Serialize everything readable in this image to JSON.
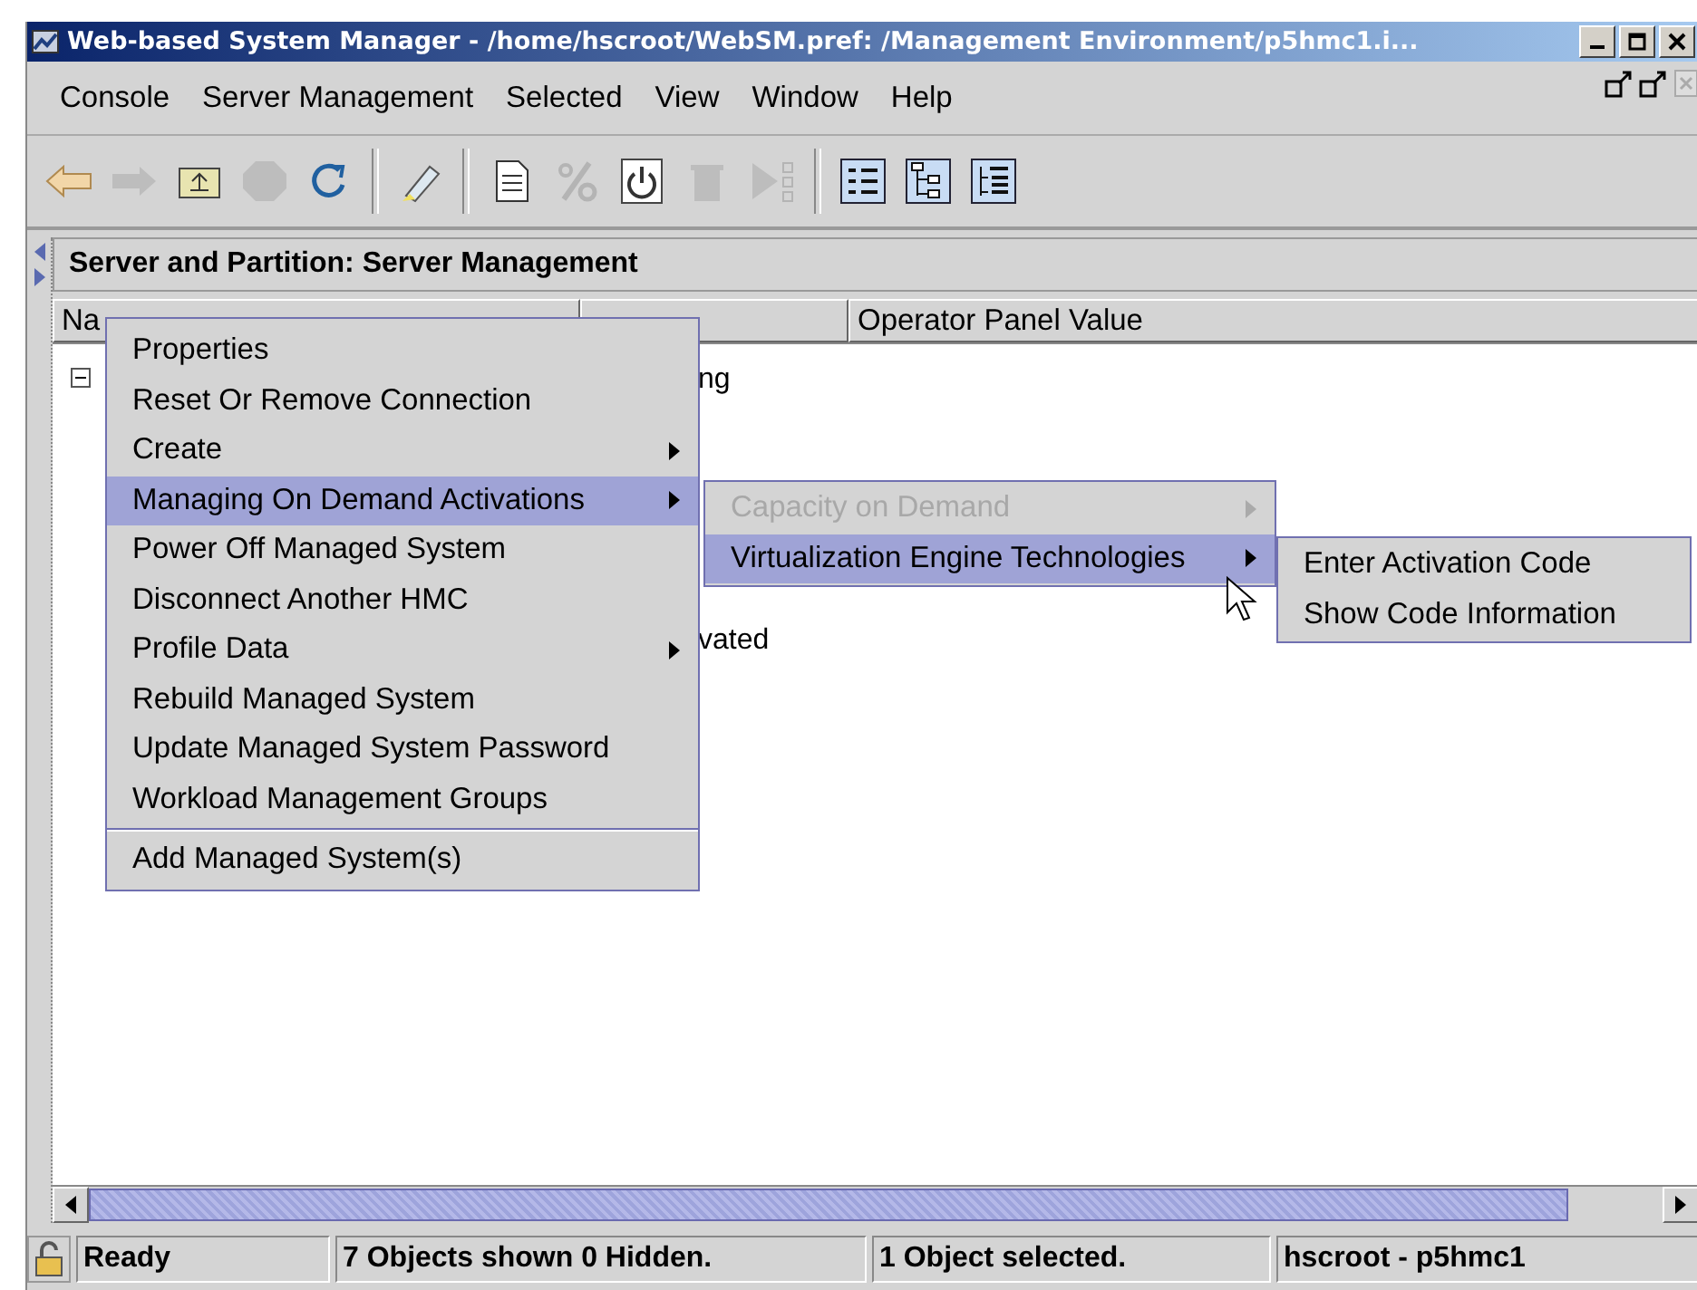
{
  "window": {
    "title": "Web-based System Manager - /home/hscroot/WebSM.pref: /Management Environment/p5hmc1.i..."
  },
  "menu_bar": [
    {
      "label": "Console"
    },
    {
      "label": "Server Management"
    },
    {
      "label": "Selected"
    },
    {
      "label": "View"
    },
    {
      "label": "Window"
    },
    {
      "label": "Help"
    }
  ],
  "toolbar": [
    [
      {
        "kind": "back",
        "disabled": false
      },
      {
        "kind": "forward",
        "disabled": true
      },
      {
        "kind": "up",
        "disabled": false
      },
      {
        "kind": "stop",
        "disabled": true
      },
      {
        "kind": "refresh",
        "disabled": false
      }
    ],
    [
      {
        "kind": "highlight",
        "disabled": false
      }
    ],
    [
      {
        "kind": "properties",
        "disabled": false
      },
      {
        "kind": "percent",
        "disabled": true
      },
      {
        "kind": "power",
        "disabled": false
      },
      {
        "kind": "delete",
        "disabled": true
      },
      {
        "kind": "run",
        "disabled": true
      }
    ],
    [
      {
        "kind": "details",
        "disabled": false
      },
      {
        "kind": "tree",
        "disabled": false
      },
      {
        "kind": "tree-table",
        "disabled": false
      }
    ]
  ],
  "panel": {
    "title": "Server and Partition: Server Management"
  },
  "table": {
    "columns": [
      {
        "label": "Na"
      },
      {
        "label": "Operator Panel Value"
      }
    ],
    "tree_node": {
      "expanded": true
    },
    "rows": [
      {
        "status": "ng"
      },
      {
        "status": "vated"
      }
    ]
  },
  "context_menu": [
    {
      "kind": "item",
      "label": "Properties",
      "submenu": false,
      "selected": false,
      "disabled": false
    },
    {
      "kind": "item",
      "label": "Reset Or Remove Connection",
      "submenu": false,
      "selected": false,
      "disabled": false
    },
    {
      "kind": "item",
      "label": "Create",
      "submenu": true,
      "selected": false,
      "disabled": false
    },
    {
      "kind": "item",
      "label": "Managing On Demand Activations",
      "submenu": true,
      "selected": true,
      "disabled": false
    },
    {
      "kind": "item",
      "label": "Power Off Managed System",
      "submenu": false,
      "selected": false,
      "disabled": false
    },
    {
      "kind": "item",
      "label": "Disconnect Another HMC",
      "submenu": false,
      "selected": false,
      "disabled": false
    },
    {
      "kind": "item",
      "label": "Profile Data",
      "submenu": true,
      "selected": false,
      "disabled": false
    },
    {
      "kind": "item",
      "label": "Rebuild Managed System",
      "submenu": false,
      "selected": false,
      "disabled": false
    },
    {
      "kind": "item",
      "label": "Update Managed System Password",
      "submenu": false,
      "selected": false,
      "disabled": false
    },
    {
      "kind": "item",
      "label": "Workload Management Groups",
      "submenu": false,
      "selected": false,
      "disabled": false
    },
    {
      "kind": "separator"
    },
    {
      "kind": "item",
      "label": "Add Managed System(s)",
      "submenu": false,
      "selected": false,
      "disabled": false
    }
  ],
  "submenu": [
    {
      "kind": "item",
      "label": "Capacity on Demand",
      "submenu": true,
      "selected": false,
      "disabled": true
    },
    {
      "kind": "item",
      "label": "Virtualization Engine Technologies",
      "submenu": true,
      "selected": true,
      "disabled": false
    }
  ],
  "submenu_2": [
    {
      "kind": "item",
      "label": "Enter Activation Code",
      "submenu": false,
      "selected": false,
      "disabled": false
    },
    {
      "kind": "item",
      "label": "Show Code Information",
      "submenu": false,
      "selected": false,
      "disabled": false
    }
  ],
  "status_bar": [
    "Ready",
    "7 Objects shown 0 Hidden.",
    "1 Object selected.",
    "hscroot - p5hmc1"
  ]
}
